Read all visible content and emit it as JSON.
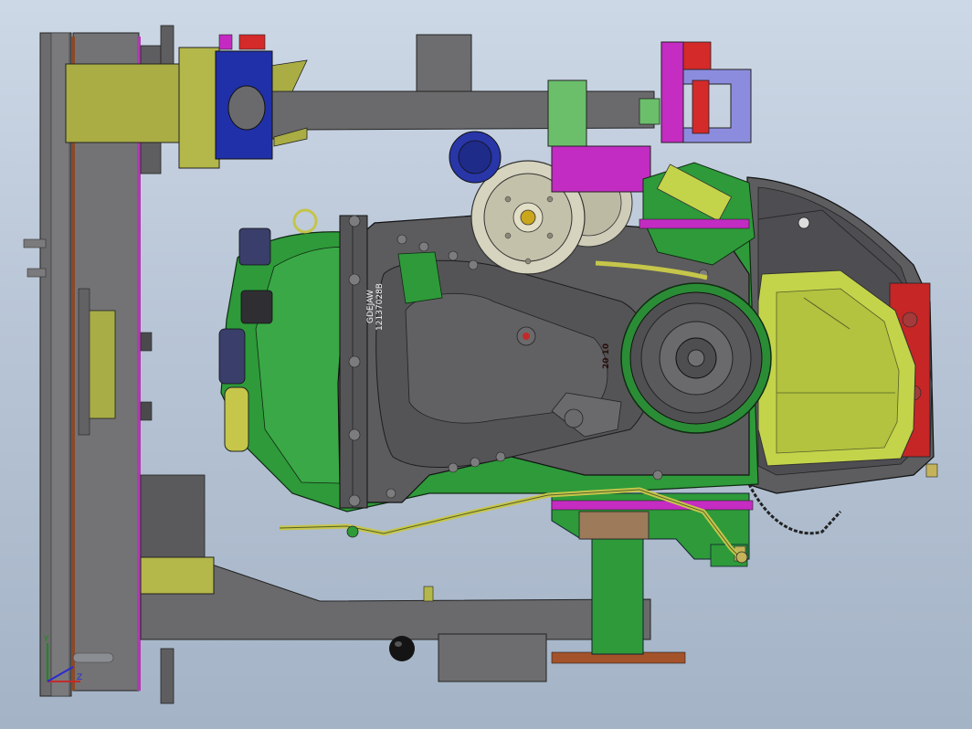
{
  "engine_block": {
    "part_number": "12137028B",
    "stamp_letters": "GDEJAW",
    "cast_numbers": "20 10"
  },
  "triad": {
    "x_label": "X",
    "y_label": "Y",
    "z_label": "Z"
  },
  "colors": {
    "background_top": "#cdd8e6",
    "background_bottom": "#a4b3c6",
    "frame_grey": "#6e6e70",
    "olive_bracket": "#b5b54a",
    "engine_green": "#2e9a3a",
    "cover_grey": "#5c5c5e",
    "lime_cover": "#c4d44a",
    "magenta_part": "#c22cc2",
    "blue_mount": "#2030a8",
    "red_clamp": "#d42a2a"
  }
}
